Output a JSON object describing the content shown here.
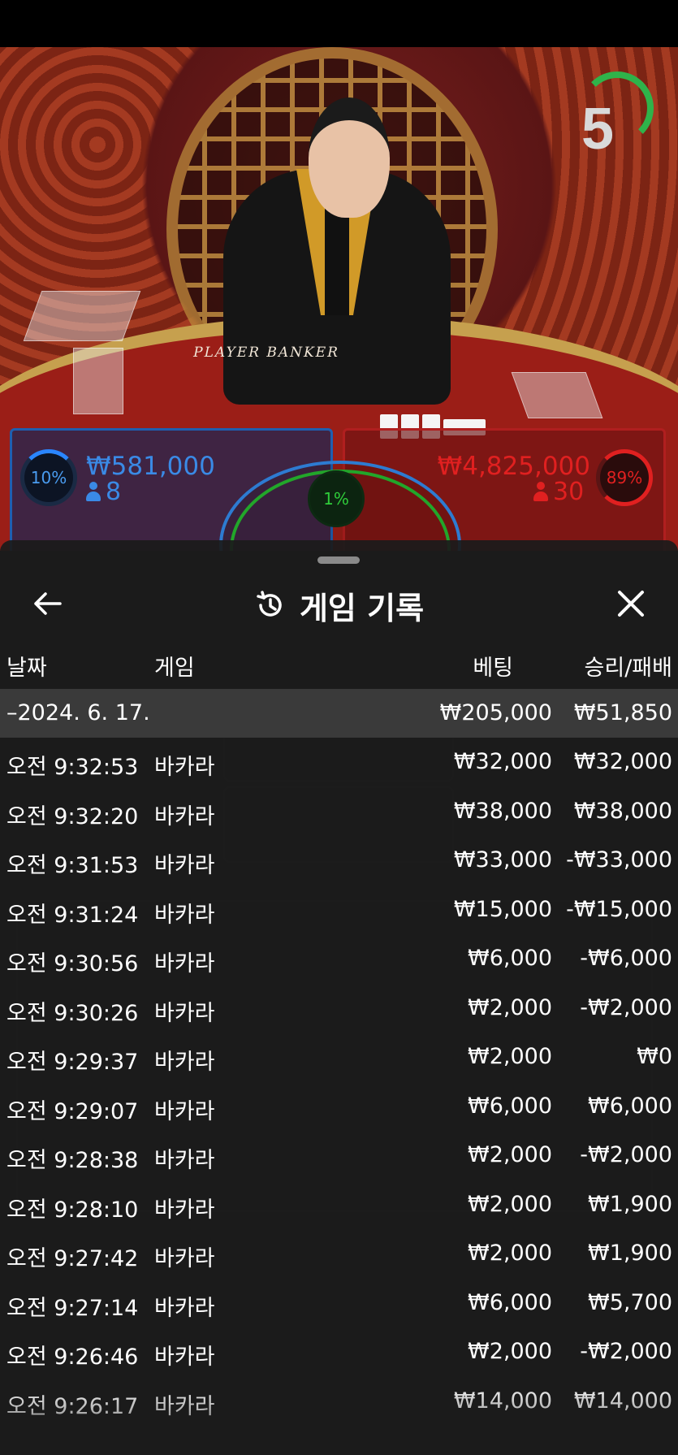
{
  "video": {
    "timer": "5",
    "table_text": "PLAYER  BANKER",
    "player": {
      "percent": "10%",
      "amount": "₩581,000",
      "players": "8"
    },
    "tie": {
      "percent": "1%"
    },
    "banker": {
      "percent": "89%",
      "amount": "₩4,825,000",
      "players": "30"
    }
  },
  "sheet": {
    "title": "게임 기록",
    "icons": {
      "back": "arrow-left-icon",
      "history": "history-icon",
      "close": "close-icon"
    },
    "columns": {
      "date": "날짜",
      "game": "게임",
      "bet": "베팅",
      "winloss": "승리/패배"
    },
    "group": {
      "date": "–2024. 6. 17.",
      "bet": "₩205,000",
      "winloss": "₩51,850"
    },
    "rows": [
      {
        "time": "오전 9:32:53",
        "game": "바카라",
        "bet": "₩32,000",
        "winloss": "₩32,000"
      },
      {
        "time": "오전 9:32:20",
        "game": "바카라",
        "bet": "₩38,000",
        "winloss": "₩38,000"
      },
      {
        "time": "오전 9:31:53",
        "game": "바카라",
        "bet": "₩33,000",
        "winloss": "-₩33,000"
      },
      {
        "time": "오전 9:31:24",
        "game": "바카라",
        "bet": "₩15,000",
        "winloss": "-₩15,000"
      },
      {
        "time": "오전 9:30:56",
        "game": "바카라",
        "bet": "₩6,000",
        "winloss": "-₩6,000"
      },
      {
        "time": "오전 9:30:26",
        "game": "바카라",
        "bet": "₩2,000",
        "winloss": "-₩2,000"
      },
      {
        "time": "오전 9:29:37",
        "game": "바카라",
        "bet": "₩2,000",
        "winloss": "₩0"
      },
      {
        "time": "오전 9:29:07",
        "game": "바카라",
        "bet": "₩6,000",
        "winloss": "₩6,000"
      },
      {
        "time": "오전 9:28:38",
        "game": "바카라",
        "bet": "₩2,000",
        "winloss": "-₩2,000"
      },
      {
        "time": "오전 9:28:10",
        "game": "바카라",
        "bet": "₩2,000",
        "winloss": "₩1,900"
      },
      {
        "time": "오전 9:27:42",
        "game": "바카라",
        "bet": "₩2,000",
        "winloss": "₩1,900"
      },
      {
        "time": "오전 9:27:14",
        "game": "바카라",
        "bet": "₩6,000",
        "winloss": "₩5,700"
      },
      {
        "time": "오전 9:26:46",
        "game": "바카라",
        "bet": "₩2,000",
        "winloss": "-₩2,000"
      },
      {
        "time": "오전 9:26:17",
        "game": "바카라",
        "bet": "₩14,000",
        "winloss": "₩14,000"
      }
    ]
  }
}
